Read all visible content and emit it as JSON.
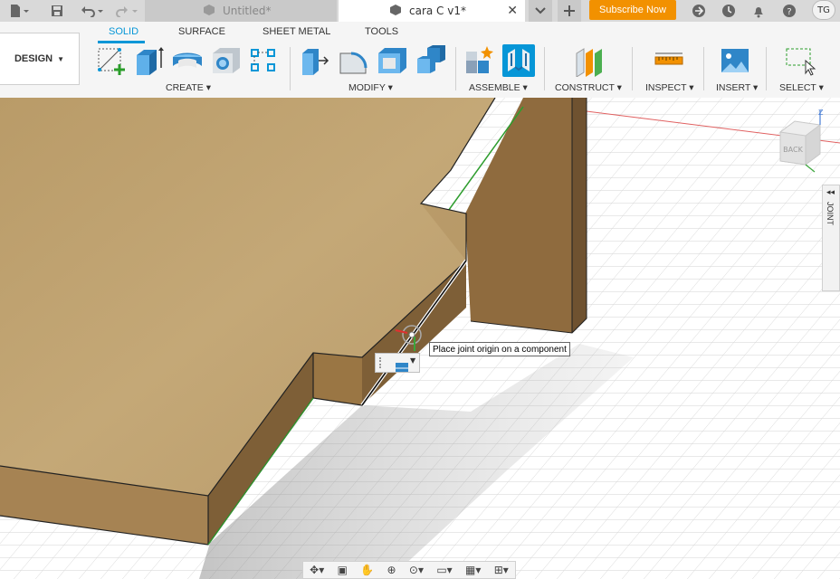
{
  "titlebar": {
    "tabs": [
      {
        "label": "Untitled*"
      },
      {
        "label": "cara C v1*"
      }
    ],
    "subscribe_label": "Subscribe Now",
    "user_initials": "TG"
  },
  "ribbon": {
    "workspace_label": "DESIGN",
    "tabs": [
      "SOLID",
      "SURFACE",
      "SHEET METAL",
      "TOOLS"
    ],
    "groups": [
      "CREATE",
      "MODIFY",
      "ASSEMBLE",
      "CONSTRUCT",
      "INSPECT",
      "INSERT",
      "SELECT"
    ]
  },
  "viewport": {
    "tooltip": "Place joint origin on a component",
    "viewcube_face": "BACK",
    "side_panel_label": "JOINT"
  },
  "colors": {
    "accent": "#0696d7",
    "subscribe": "#f29100",
    "wood_top": "#c0a472",
    "wood_side": "#8c6a40"
  }
}
